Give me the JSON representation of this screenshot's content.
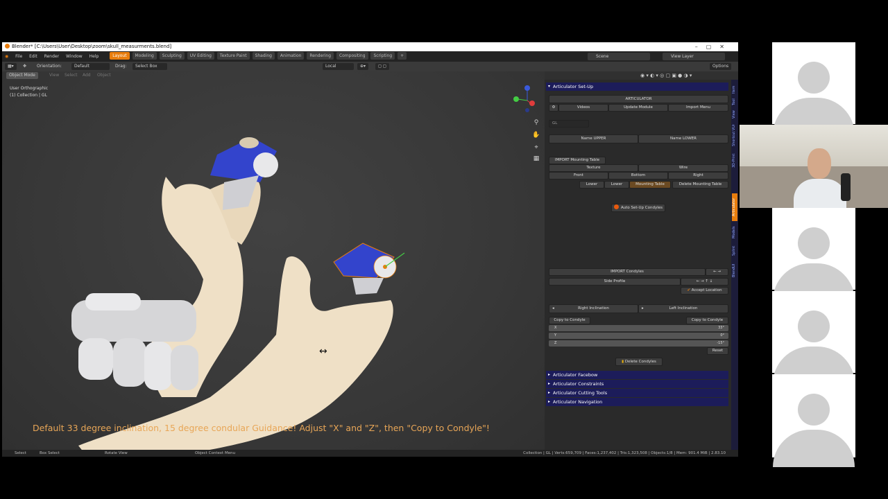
{
  "window": {
    "title": "Blender* [C:\\Users\\User\\Desktop\\zoom\\skull_measurments.blend]"
  },
  "menu": {
    "items": [
      "File",
      "Edit",
      "Render",
      "Window",
      "Help"
    ],
    "workspaces": [
      "Layout",
      "Modeling",
      "Sculpting",
      "UV Editing",
      "Texture Paint",
      "Shading",
      "Animation",
      "Rendering",
      "Compositing",
      "Scripting"
    ],
    "active_workspace": "Layout",
    "scene": "Scene",
    "view_layer": "View Layer"
  },
  "toolbar": {
    "orientation_label": "Orientation:",
    "orientation_value": "Default",
    "drag_label": "Drag:",
    "drag_value": "Select Box",
    "pivot_value": "Local",
    "options": "Options"
  },
  "viewport": {
    "mode": "Object Mode",
    "header_items": [
      "View",
      "Select",
      "Add",
      "Object"
    ],
    "view_name": "User Orthographic",
    "collection": "(1) Collection | GL",
    "instruction": "Default 33 degree inclination, 15 degree condular Guidance! Adjust \"X\" and \"Z\", then \"Copy to Condyle\"!"
  },
  "panel": {
    "title": "Articulator Set-Up",
    "articulator_btn": "ARTICULATOR",
    "videos": "Videos",
    "update_module": "Update Module",
    "import_menu": "Import Menu",
    "gl_field": "GL",
    "name_upper": "Name UPPER",
    "name_lower": "Name LOWER",
    "import_mounting_table": "IMPORT  Mounting Table",
    "texture": "Texture",
    "wire": "Wire",
    "front": "Front",
    "bottom": "Bottom",
    "right": "Right",
    "lower1": "Lower",
    "lower2": "Lower",
    "mounting_table": "Mounting Table",
    "delete_mounting_table": "Delete Mounting Table",
    "auto_setup_condyles": "Auto Set-Up Condyles",
    "import_condyles": "IMPORT Condyles",
    "side_profile": "Side Profile",
    "accept_location": "Accept Location",
    "right_inclination": "Right Inclination",
    "left_inclination": "Left Inclination",
    "copy_to_condyle_l": "Copy to Condyle",
    "copy_to_condyle_r": "Copy to Condyle",
    "slider_x": {
      "label": "X",
      "value": "33°"
    },
    "slider_y": {
      "label": "Y",
      "value": "0°"
    },
    "slider_z": {
      "label": "Z",
      "value": "-15°"
    },
    "reset": "Reset",
    "delete_condyles": "Delete Condyles",
    "sections": [
      "Articulator Facebow",
      "Articulator Constraints",
      "Articulator Cutting Tools",
      "Articulator Navigation"
    ]
  },
  "tabs": [
    "Item",
    "Tool",
    "View",
    "Shortcut VUr",
    "3D-Print",
    "Articulator",
    "Models",
    "Splint",
    "BlendUI"
  ],
  "status": {
    "select": "Select",
    "box_select": "Box Select",
    "rotate_view": "Rotate View",
    "context_menu": "Object Context Menu",
    "stats": "Collection | GL | Verts:659,709 | Faces:1,237,402 | Tris:1,323,508 | Objects:1/8 | Mem: 901.4 MiB | 2.83.10"
  },
  "colors": {
    "accent": "#e87d0d",
    "panel_header": "#1c1c5a",
    "bone": "#efe0c6",
    "condyle_blue": "#3344cc",
    "instruction_text": "#e8a657"
  }
}
